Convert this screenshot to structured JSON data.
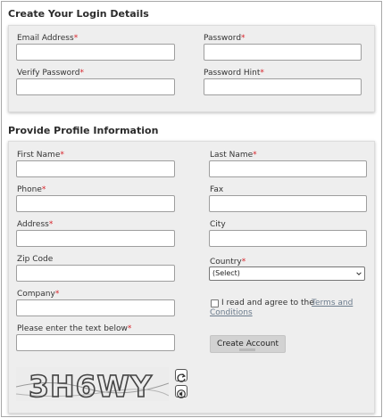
{
  "login": {
    "title": "Create Your Login Details",
    "email_label": "Email Address",
    "password_label": "Password",
    "verify_label": "Verify Password",
    "hint_label": "Password Hint"
  },
  "profile": {
    "title": "Provide Profile Information",
    "first_name_label": "First Name",
    "last_name_label": "Last Name",
    "phone_label": "Phone",
    "fax_label": "Fax",
    "address_label": "Address",
    "city_label": "City",
    "zip_label": "Zip Code",
    "country_label": "Country",
    "country_value": "(Select)",
    "company_label": "Company",
    "agree_text": "I read and agree to the ",
    "terms_link": "Terms and Conditions",
    "captcha_label": "Please enter the text below",
    "create_button": "Create Account"
  },
  "required_mark": "*",
  "captcha_text": "3H6WY",
  "icons": {
    "refresh": "refresh-icon",
    "audio": "audio-icon"
  },
  "colors": {
    "required": "#d8232a",
    "panel": "#eeeeee",
    "link": "#6b7b8c"
  }
}
